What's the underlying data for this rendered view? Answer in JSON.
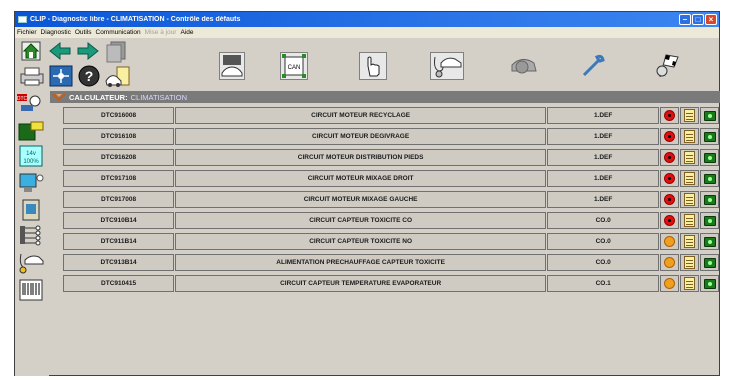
{
  "window": {
    "title": "CLIP - Diagnostic libre - CLIMATISATION - Contrôle des défauts"
  },
  "menu": [
    {
      "label": "Fichier",
      "enabled": true
    },
    {
      "label": "Diagnostic",
      "enabled": true
    },
    {
      "label": "Outils",
      "enabled": true
    },
    {
      "label": "Communication",
      "enabled": true
    },
    {
      "label": "Mise à jour",
      "enabled": false
    },
    {
      "label": "Aide",
      "enabled": true
    }
  ],
  "header": {
    "label": "CALCULATEUR:",
    "value": "CLIMATISATION"
  },
  "toolbar_icons": [
    "home-icon",
    "back-arrow-icon",
    "forward-arrow-icon",
    "documents-icon",
    "printer-icon",
    "network-icon",
    "help-icon",
    "car-doc-icon",
    "ecu-car-icon",
    "can-bus-icon",
    "hand-pointer-icon",
    "car-stethoscope-icon",
    "car-gear-icon",
    "wrench-icon",
    "race-flags-icon"
  ],
  "sidebar_icons": [
    "dtc-icon",
    "dtc-ecu-icon",
    "voltage-14v-icon",
    "computer-icon",
    "document-icon",
    "tree-icon",
    "car-diagnostic-icon",
    "barcode-icon"
  ],
  "sidebar_text": {
    "dtc": "DTC",
    "voltage": "14v\n100%"
  },
  "colors": {
    "titlebar": "#0a56d6",
    "header_bar": "#7a7a7a",
    "fault_present": "#e01010",
    "fault_memorized": "#f0a020",
    "cell_bg": "#cfcbc3"
  },
  "faults": [
    {
      "code": "DTC916008",
      "description": "CIRCUIT MOTEUR RECYCLAGE",
      "status": "1.DEF",
      "state": "red"
    },
    {
      "code": "DTC916108",
      "description": "CIRCUIT MOTEUR DEGIVRAGE",
      "status": "1.DEF",
      "state": "red"
    },
    {
      "code": "DTC916208",
      "description": "CIRCUIT MOTEUR DISTRIBUTION PIEDS",
      "status": "1.DEF",
      "state": "red"
    },
    {
      "code": "DTC917108",
      "description": "CIRCUIT MOTEUR MIXAGE DROIT",
      "status": "1.DEF",
      "state": "red"
    },
    {
      "code": "DTC917008",
      "description": "CIRCUIT MOTEUR MIXAGE GAUCHE",
      "status": "1.DEF",
      "state": "red"
    },
    {
      "code": "DTC910B14",
      "description": "CIRCUIT CAPTEUR TOXICITE CO",
      "status": "CO.0",
      "state": "red"
    },
    {
      "code": "DTC911B14",
      "description": "CIRCUIT CAPTEUR TOXICITE NO",
      "status": "CO.0",
      "state": "orange"
    },
    {
      "code": "DTC913B14",
      "description": "ALIMENTATION PRECHAUFFAGE CAPTEUR TOXICITE",
      "status": "CO.0",
      "state": "orange"
    },
    {
      "code": "DTC910415",
      "description": "CIRCUIT CAPTEUR TEMPERATURE EVAPORATEUR",
      "status": "CO.1",
      "state": "orange"
    }
  ]
}
